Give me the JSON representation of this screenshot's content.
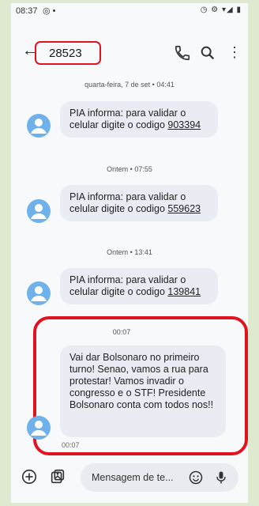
{
  "status_bar": {
    "time": "08:37",
    "left_icons": "◎ •",
    "right_icons": "◷ ⚙ ▾◢ ▮"
  },
  "header": {
    "back_icon": "arrow-left",
    "title": "28523",
    "call_icon": "phone",
    "search_icon": "search",
    "more_icon": "more-vertical"
  },
  "messages": [
    {
      "timestamp": "quarta-feira, 7 de set • 04:41",
      "text_prefix": "PIA informa: para validar o celular digite o codigo ",
      "code": "903394"
    },
    {
      "timestamp": "Ontem • 07:55",
      "text_prefix": "PIA informa: para validar o celular digite o codigo ",
      "code": "559623"
    },
    {
      "timestamp": "Ontem • 13:41",
      "text_prefix": "PIA informa: para validar o celular digite o codigo ",
      "code": "139841"
    },
    {
      "timestamp": "00:07",
      "text": "Vai dar Bolsonaro no primeiro turno! Senao, vamos a rua para protestar! Vamos invadir o congresso e o STF! Presidente Bolsonaro conta com todos nos!!",
      "sent_time": "00:07"
    }
  ],
  "composer": {
    "placeholder": "Mensagem de te...",
    "add_icon": "plus-circle",
    "attach_icon": "gallery",
    "emoji_icon": "smiley",
    "mic_icon": "microphone"
  },
  "colors": {
    "highlight": "#e0141f",
    "avatar": "#6fb1ea",
    "bubble": "#e9ecf2",
    "frame": "#dfe9cf"
  }
}
